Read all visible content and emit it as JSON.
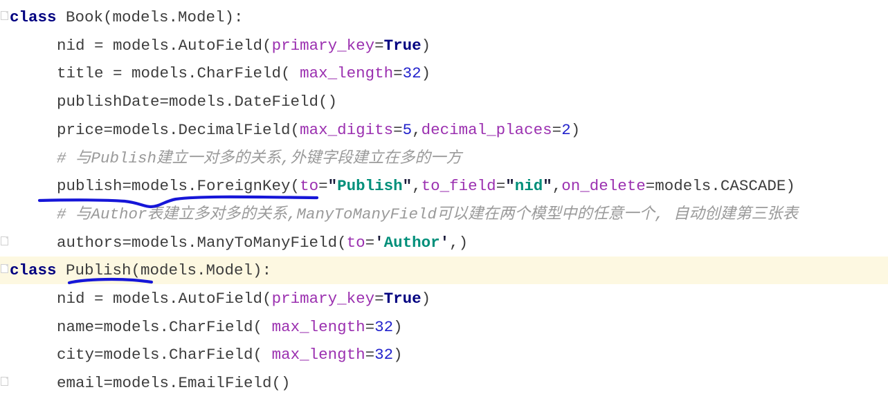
{
  "editor": {
    "background": "#ffffff",
    "highlight_color": "#fdf8e1",
    "annotation_color": "#1616d8",
    "colors": {
      "keyword": "#000080",
      "parameter": "#9b30b0",
      "number": "#2222cc",
      "string": "#008f7a",
      "comment": "#9a9a9a",
      "plain": "#3d3d3d"
    }
  },
  "code_lines": [
    {
      "id": "line-class-book",
      "indent": 0,
      "highlighted": false,
      "fold_marker": true,
      "tokens": [
        {
          "t": "class",
          "c": "kw"
        },
        {
          "t": " Book(models.Model):",
          "c": "plain"
        }
      ]
    },
    {
      "id": "line-nid-book",
      "indent": 1,
      "highlighted": false,
      "fold_marker": false,
      "tokens": [
        {
          "t": "nid = models.AutoField(",
          "c": "plain"
        },
        {
          "t": "primary_key",
          "c": "param"
        },
        {
          "t": "=",
          "c": "plain"
        },
        {
          "t": "True",
          "c": "bool"
        },
        {
          "t": ")",
          "c": "plain"
        }
      ]
    },
    {
      "id": "line-title",
      "indent": 1,
      "highlighted": false,
      "fold_marker": false,
      "tokens": [
        {
          "t": "title = models.CharField( ",
          "c": "plain"
        },
        {
          "t": "max_length",
          "c": "param"
        },
        {
          "t": "=",
          "c": "plain"
        },
        {
          "t": "32",
          "c": "num"
        },
        {
          "t": ")",
          "c": "plain"
        }
      ]
    },
    {
      "id": "line-publishdate",
      "indent": 1,
      "highlighted": false,
      "fold_marker": false,
      "tokens": [
        {
          "t": "publishDate=models.DateField()",
          "c": "plain"
        }
      ]
    },
    {
      "id": "line-price",
      "indent": 1,
      "highlighted": false,
      "fold_marker": false,
      "tokens": [
        {
          "t": "price=models.DecimalField(",
          "c": "plain"
        },
        {
          "t": "max_digits",
          "c": "param"
        },
        {
          "t": "=",
          "c": "plain"
        },
        {
          "t": "5",
          "c": "num"
        },
        {
          "t": ",",
          "c": "plain"
        },
        {
          "t": "decimal_places",
          "c": "param"
        },
        {
          "t": "=",
          "c": "plain"
        },
        {
          "t": "2",
          "c": "num"
        },
        {
          "t": ")",
          "c": "plain"
        }
      ]
    },
    {
      "id": "line-comment-publish",
      "indent": 1,
      "highlighted": false,
      "fold_marker": false,
      "tokens": [
        {
          "t": "# 与Publish建立一对多的关系,外键字段建立在多的一方",
          "c": "comment"
        }
      ]
    },
    {
      "id": "line-publish-fk",
      "indent": 1,
      "highlighted": false,
      "fold_marker": false,
      "tokens": [
        {
          "t": "publish=models.ForeignKey(",
          "c": "plain"
        },
        {
          "t": "to",
          "c": "param"
        },
        {
          "t": "=",
          "c": "plain"
        },
        {
          "t": "\"",
          "c": "quote"
        },
        {
          "t": "Publish",
          "c": "str"
        },
        {
          "t": "\"",
          "c": "quote"
        },
        {
          "t": ",",
          "c": "plain"
        },
        {
          "t": "to_field",
          "c": "param"
        },
        {
          "t": "=",
          "c": "plain"
        },
        {
          "t": "\"",
          "c": "quote"
        },
        {
          "t": "nid",
          "c": "str"
        },
        {
          "t": "\"",
          "c": "quote"
        },
        {
          "t": ",",
          "c": "plain"
        },
        {
          "t": "on_delete",
          "c": "param"
        },
        {
          "t": "=models.CASCADE)",
          "c": "plain"
        }
      ]
    },
    {
      "id": "line-comment-author",
      "indent": 1,
      "highlighted": false,
      "fold_marker": false,
      "tokens": [
        {
          "t": "# 与Author表建立多对多的关系,ManyToManyField可以建在两个模型中的任意一个, 自动创建第三张表",
          "c": "comment"
        }
      ]
    },
    {
      "id": "line-authors-m2m",
      "indent": 1,
      "highlighted": false,
      "fold_marker": true,
      "tokens": [
        {
          "t": "authors=models.ManyToManyField(",
          "c": "plain"
        },
        {
          "t": "to",
          "c": "param"
        },
        {
          "t": "=",
          "c": "plain"
        },
        {
          "t": "'",
          "c": "quote"
        },
        {
          "t": "Author",
          "c": "str"
        },
        {
          "t": "'",
          "c": "quote"
        },
        {
          "t": ",)",
          "c": "plain"
        }
      ]
    },
    {
      "id": "line-class-publish",
      "indent": 0,
      "highlighted": true,
      "fold_marker": true,
      "tokens": [
        {
          "t": "class",
          "c": "kw"
        },
        {
          "t": " Publish(models.Model):",
          "c": "plain"
        }
      ]
    },
    {
      "id": "line-nid-publish",
      "indent": 1,
      "highlighted": false,
      "fold_marker": false,
      "tokens": [
        {
          "t": "nid = models.AutoField(",
          "c": "plain"
        },
        {
          "t": "primary_key",
          "c": "param"
        },
        {
          "t": "=",
          "c": "plain"
        },
        {
          "t": "True",
          "c": "bool"
        },
        {
          "t": ")",
          "c": "plain"
        }
      ]
    },
    {
      "id": "line-name",
      "indent": 1,
      "highlighted": false,
      "fold_marker": false,
      "tokens": [
        {
          "t": "name=models.CharField( ",
          "c": "plain"
        },
        {
          "t": "max_length",
          "c": "param"
        },
        {
          "t": "=",
          "c": "plain"
        },
        {
          "t": "32",
          "c": "num"
        },
        {
          "t": ")",
          "c": "plain"
        }
      ]
    },
    {
      "id": "line-city",
      "indent": 1,
      "highlighted": false,
      "fold_marker": false,
      "tokens": [
        {
          "t": "city=models.CharField( ",
          "c": "plain"
        },
        {
          "t": "max_length",
          "c": "param"
        },
        {
          "t": "=",
          "c": "plain"
        },
        {
          "t": "32",
          "c": "num"
        },
        {
          "t": ")",
          "c": "plain"
        }
      ]
    },
    {
      "id": "line-email",
      "indent": 1,
      "highlighted": false,
      "fold_marker": true,
      "tokens": [
        {
          "t": "email=models.EmailField()",
          "c": "plain"
        }
      ]
    }
  ],
  "annotations": [
    {
      "id": "underline-foreignkey",
      "shape": "wavy-underline",
      "color": "#1616d8",
      "target_line": "line-publish-fk"
    },
    {
      "id": "underline-publish-classname",
      "shape": "underline",
      "color": "#1616d8",
      "target_line": "line-class-publish"
    }
  ]
}
